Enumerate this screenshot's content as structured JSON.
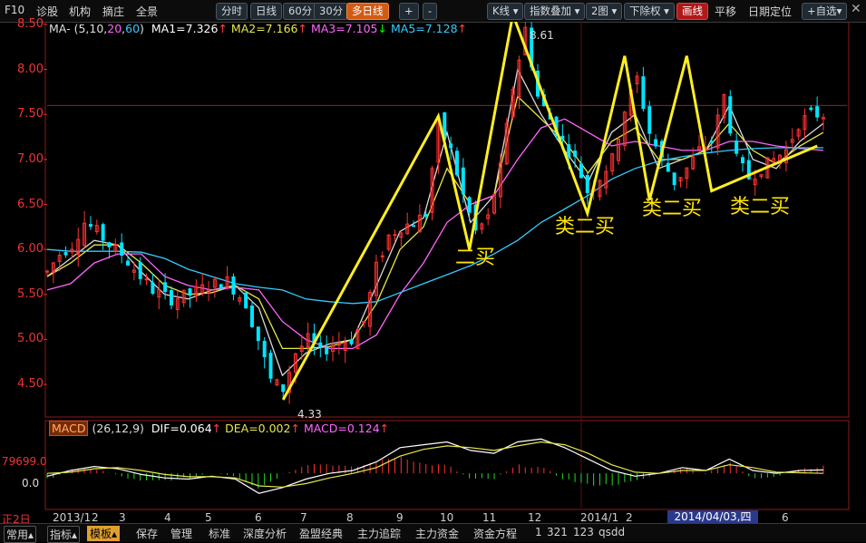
{
  "toolbar": {
    "f10": "F10",
    "links": [
      "诊股",
      "机构",
      "摘庄",
      "全景"
    ],
    "period_tabs": [
      "分时",
      "日线",
      "60分",
      "30分",
      "多日线"
    ],
    "nav_buttons": [
      "+",
      "-"
    ],
    "k_type": "K线",
    "overlay": "指数叠加",
    "layout": "2图",
    "rights": "下除权",
    "draw": "画线",
    "pan": "平移",
    "date_locate": "日期定位",
    "watchlist": "+自选",
    "close": "✕"
  },
  "ma_panel": {
    "name": "MA",
    "params_prefix": "(5,10,",
    "param_20": "20",
    "comma": ",",
    "param_60": "60",
    "params_suffix": ")",
    "ma1": "MA1=7.326",
    "ma2": "MA2=7.166",
    "ma3": "MA3=7.105",
    "ma5": "MA5=7.128",
    "arrow_up": "↑",
    "arrow_down": "↓",
    "high_label": "8.61",
    "low_label": "4.33",
    "annotations": [
      "二买",
      "类二买",
      "类二买",
      "类二买"
    ]
  },
  "macd_panel": {
    "name": "MACD",
    "params": "(26,12,9)",
    "dif": "DIF=0.064",
    "dea": "DEA=0.002",
    "macd": "MACD=0.124",
    "left_value": "79699.0",
    "zero": "0.0"
  },
  "x_axis": {
    "left_tag": "正2日",
    "labels": [
      "2013/1",
      "2",
      "3",
      "4",
      "5",
      "6",
      "7",
      "8",
      "9",
      "10",
      "11",
      "12",
      "2014/1",
      "2",
      "6"
    ],
    "cursor_date": "2014/04/03,四"
  },
  "bottom_bar": {
    "tabs": [
      "常用",
      "指标",
      "模板",
      "保存",
      "管理",
      "标准",
      "深度分析",
      "盈盟经典",
      "主力追踪",
      "主力资金",
      "资金方程"
    ],
    "numbers": [
      "1",
      "321",
      "123"
    ],
    "tail": "qsdd"
  },
  "colors": {
    "up": "#ff3232",
    "down": "#00e5ff",
    "ma5": "#ffffff",
    "ma10": "#e8e84a",
    "ma20": "#ff66ff",
    "ma60": "#33ccff",
    "zigzag": "#ffee22",
    "grid": "#8b1a1a"
  },
  "chart_data": [
    {
      "type": "candlestick",
      "title": "",
      "ylim": [
        4.3,
        8.65
      ],
      "y_ticks": [
        4.5,
        5.0,
        5.5,
        6.0,
        6.5,
        7.0,
        7.5,
        8.0,
        8.5
      ],
      "x_tick_labels": [
        "2013/1",
        "2",
        "3",
        "4",
        "5",
        "6",
        "7",
        "8",
        "9",
        "10",
        "11",
        "12",
        "2014/1",
        "2",
        "6"
      ],
      "ma_values": {
        "MA1": 7.326,
        "MA2": 7.166,
        "MA3": 7.105,
        "MA5": 7.128
      },
      "price_path": [
        [
          0,
          5.75
        ],
        [
          2,
          5.95
        ],
        [
          4,
          6.05
        ],
        [
          6,
          6.3
        ],
        [
          8,
          6.2
        ],
        [
          10,
          6.05
        ],
        [
          12,
          5.95
        ],
        [
          15,
          5.7
        ],
        [
          17,
          5.55
        ],
        [
          20,
          5.45
        ],
        [
          23,
          5.5
        ],
        [
          26,
          5.6
        ],
        [
          29,
          5.65
        ],
        [
          32,
          5.4
        ],
        [
          34,
          5.0
        ],
        [
          36,
          4.55
        ],
        [
          38,
          4.45
        ],
        [
          40,
          4.85
        ],
        [
          42,
          5.0
        ],
        [
          44,
          4.85
        ],
        [
          46,
          4.95
        ],
        [
          49,
          5.0
        ],
        [
          51,
          5.2
        ],
        [
          53,
          5.8
        ],
        [
          55,
          6.15
        ],
        [
          57,
          6.25
        ],
        [
          59,
          6.3
        ],
        [
          61,
          6.4
        ],
        [
          63,
          7.4
        ],
        [
          65,
          7.1
        ],
        [
          67,
          6.6
        ],
        [
          69,
          6.2
        ],
        [
          71,
          6.35
        ],
        [
          73,
          6.9
        ],
        [
          75,
          7.8
        ],
        [
          77,
          8.45
        ],
        [
          79,
          7.7
        ],
        [
          81,
          7.45
        ],
        [
          83,
          7.2
        ],
        [
          85,
          7.0
        ],
        [
          87,
          6.65
        ],
        [
          89,
          6.8
        ],
        [
          91,
          7.0
        ],
        [
          93,
          7.55
        ],
        [
          95,
          7.9
        ],
        [
          97,
          7.3
        ],
        [
          99,
          7.0
        ],
        [
          101,
          6.75
        ],
        [
          103,
          6.9
        ],
        [
          105,
          7.1
        ],
        [
          107,
          7.2
        ],
        [
          109,
          7.7
        ],
        [
          111,
          7.0
        ],
        [
          113,
          6.8
        ],
        [
          115,
          6.9
        ],
        [
          117,
          7.0
        ],
        [
          119,
          7.1
        ],
        [
          121,
          7.4
        ],
        [
          123,
          7.5
        ]
      ],
      "zigzag_points": [
        [
          38,
          4.33
        ],
        [
          63,
          7.48
        ],
        [
          68,
          6.0
        ],
        [
          75,
          8.61
        ],
        [
          87,
          6.4
        ],
        [
          93,
          8.15
        ],
        [
          97,
          6.55
        ],
        [
          103,
          8.15
        ],
        [
          107,
          6.65
        ],
        [
          124,
          7.15
        ]
      ],
      "series": [
        {
          "name": "MA1",
          "values": [
            5.7,
            5.9,
            6.1,
            6.05,
            5.75,
            5.5,
            5.45,
            5.55,
            5.6,
            5.35,
            4.6,
            4.85,
            4.95,
            5.0,
            5.6,
            6.2,
            6.35,
            7.3,
            6.3,
            6.6,
            8.0,
            7.5,
            7.1,
            6.75,
            7.3,
            7.5,
            6.9,
            7.0,
            7.1,
            7.6,
            7.0,
            6.9,
            7.2,
            7.4
          ]
        },
        {
          "name": "MA2",
          "values": [
            5.7,
            5.85,
            6.05,
            6.05,
            5.85,
            5.6,
            5.5,
            5.52,
            5.6,
            5.45,
            4.9,
            4.9,
            4.92,
            5.0,
            5.4,
            6.0,
            6.25,
            6.9,
            6.5,
            6.6,
            7.7,
            7.45,
            7.2,
            6.85,
            7.2,
            7.35,
            7.0,
            7.0,
            7.1,
            7.4,
            7.1,
            6.95,
            7.15,
            7.3
          ]
        },
        {
          "name": "MA3",
          "values": [
            5.55,
            5.62,
            5.85,
            5.95,
            5.95,
            5.7,
            5.6,
            5.55,
            5.58,
            5.55,
            5.2,
            5.0,
            4.9,
            4.9,
            5.05,
            5.5,
            5.85,
            6.3,
            6.5,
            6.6,
            7.0,
            7.35,
            7.45,
            7.3,
            7.15,
            7.2,
            7.15,
            7.1,
            7.1,
            7.2,
            7.2,
            7.15,
            7.12,
            7.1
          ]
        },
        {
          "name": "MA5",
          "values": [
            6.0,
            5.98,
            5.98,
            5.98,
            5.97,
            5.9,
            5.78,
            5.7,
            5.62,
            5.58,
            5.55,
            5.45,
            5.42,
            5.4,
            5.42,
            5.52,
            5.62,
            5.72,
            5.82,
            5.95,
            6.1,
            6.3,
            6.45,
            6.6,
            6.78,
            6.9,
            6.98,
            7.03,
            7.07,
            7.1,
            7.12,
            7.13,
            7.13,
            7.13
          ]
        }
      ]
    },
    {
      "type": "macd",
      "title": "",
      "ylim": [
        -0.6,
        0.7
      ],
      "dif": 0.064,
      "dea": 0.002,
      "macd": 0.124,
      "series": [
        {
          "name": "DIF",
          "values": [
            -0.05,
            0.05,
            0.12,
            0.08,
            -0.02,
            -0.08,
            -0.1,
            -0.05,
            -0.1,
            -0.35,
            -0.25,
            -0.1,
            0.0,
            0.05,
            0.2,
            0.45,
            0.5,
            0.55,
            0.4,
            0.35,
            0.55,
            0.6,
            0.45,
            0.25,
            0.05,
            -0.05,
            0.0,
            0.1,
            0.05,
            0.25,
            0.05,
            0.0,
            0.05,
            0.06
          ]
        },
        {
          "name": "DEA",
          "values": [
            0.0,
            0.02,
            0.08,
            0.1,
            0.05,
            -0.02,
            -0.06,
            -0.06,
            -0.08,
            -0.22,
            -0.24,
            -0.18,
            -0.08,
            0.0,
            0.1,
            0.3,
            0.42,
            0.48,
            0.45,
            0.4,
            0.48,
            0.55,
            0.5,
            0.35,
            0.15,
            0.02,
            0.0,
            0.05,
            0.05,
            0.15,
            0.1,
            0.02,
            0.01,
            0.0
          ]
        },
        {
          "name": "MACD",
          "values": [
            -0.1,
            0.06,
            0.08,
            -0.04,
            -0.14,
            -0.12,
            -0.08,
            0.02,
            -0.04,
            -0.26,
            -0.02,
            0.16,
            0.16,
            0.1,
            0.2,
            0.3,
            0.16,
            0.14,
            -0.1,
            -0.1,
            0.14,
            0.1,
            -0.1,
            -0.2,
            -0.2,
            -0.14,
            0.0,
            0.1,
            0.0,
            0.2,
            -0.1,
            -0.04,
            0.08,
            0.12
          ]
        }
      ]
    }
  ]
}
